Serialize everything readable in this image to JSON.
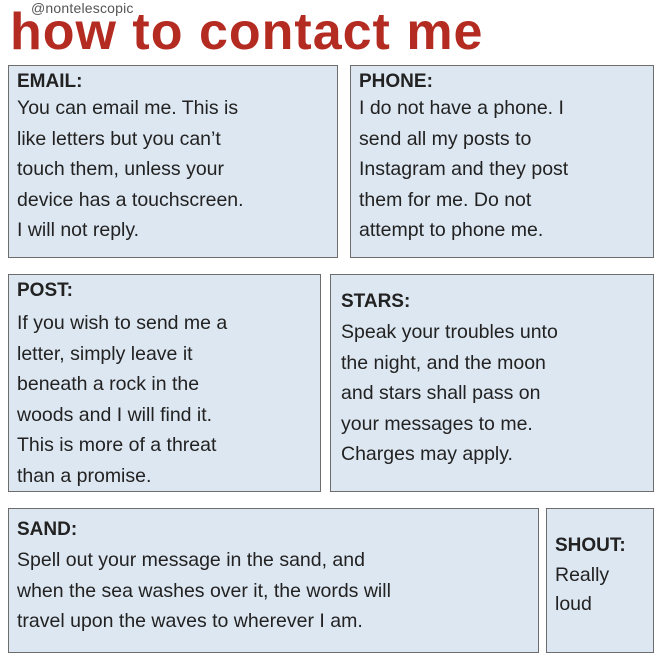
{
  "handle": "@nontelescopic",
  "title": "how to contact me",
  "boxes": {
    "email": {
      "heading": "EMAIL:",
      "lines": [
        "You can email me. This is",
        "like letters but you can’t",
        "touch them, unless your",
        "device has a touchscreen.",
        "I will not reply."
      ]
    },
    "phone": {
      "heading": "PHONE:",
      "lines": [
        "I do not have a phone. I",
        "send all my posts to",
        "Instagram and they post",
        "them for me. Do not",
        "attempt to phone me."
      ]
    },
    "post": {
      "heading": "POST:",
      "lines": [
        "If you wish to send me a",
        "letter, simply leave it",
        "beneath a rock in the",
        "woods and I will find it.",
        "This is more of a threat",
        "than a promise."
      ]
    },
    "stars": {
      "heading": "STARS:",
      "lines": [
        "Speak your troubles unto",
        "the night, and the moon",
        "and stars shall pass on",
        "your messages to me.",
        "Charges may apply."
      ]
    },
    "sand": {
      "heading": "SAND:",
      "lines": [
        "Spell out your message in the sand, and",
        "when the sea washes over it, the words will",
        "travel upon the waves to wherever I am."
      ]
    },
    "shout": {
      "heading": "SHOUT:",
      "lines": [
        "Really",
        "loud"
      ]
    }
  },
  "colors": {
    "title": "#b42b22",
    "box_fill": "#dde7f1",
    "box_border": "#6d6d6d",
    "text": "#222222"
  }
}
